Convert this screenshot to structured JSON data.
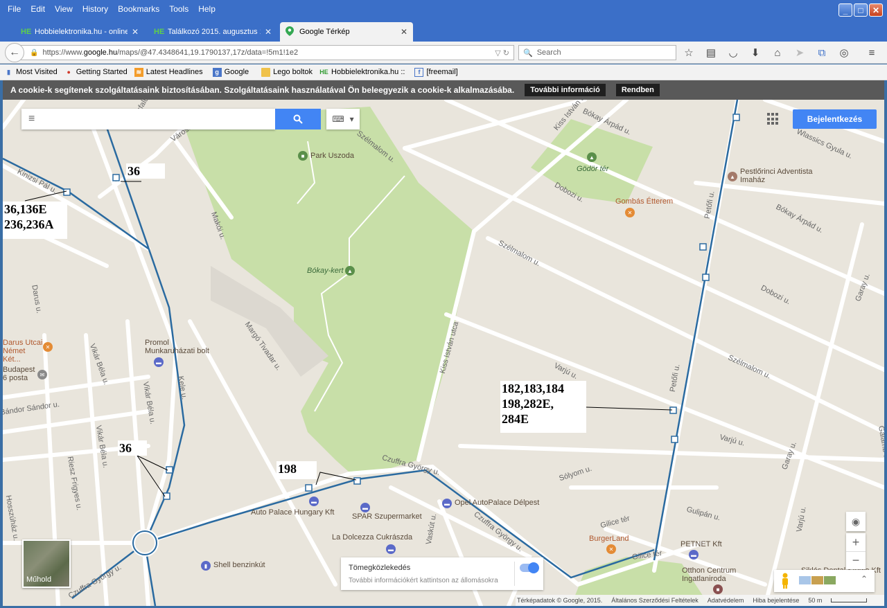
{
  "menu": [
    "File",
    "Edit",
    "View",
    "History",
    "Bookmarks",
    "Tools",
    "Help"
  ],
  "tabs": [
    {
      "favicon": "HE",
      "title": "Hobbielektronika.hu - online e..."
    },
    {
      "favicon": "HE",
      "title": "Találkozó 2015. augusztus 15...."
    },
    {
      "favicon": "maps-icon",
      "title": "Google Térkép"
    }
  ],
  "url": {
    "prefix": "https://www.",
    "host": "google.hu",
    "path": "/maps/@47.4348641,19.1790137,17z/data=!5m1!1e2"
  },
  "search_placeholder": "Search",
  "bookmarks": [
    {
      "icon": "bookmark-icon",
      "label": "Most Visited"
    },
    {
      "icon": "firefox-icon",
      "label": "Getting Started"
    },
    {
      "icon": "rss-icon",
      "label": "Latest Headlines"
    },
    {
      "icon": "google-icon",
      "label": "Google"
    },
    {
      "icon": "folder-icon",
      "label": "Lego boltok"
    },
    {
      "icon": "he-icon",
      "label": "Hobbielektronika.hu ::"
    },
    {
      "icon": "freemail-icon",
      "label": "[freemail]"
    }
  ],
  "cookie": {
    "text": "A cookie-k segítenek szolgáltatásaink biztosításában. Szolgáltatásaink használatával Ön beleegyezik a cookie-k alkalmazásába.",
    "more_label": "További információ",
    "ok_label": "Rendben"
  },
  "map": {
    "signin_label": "Bejelentkezés",
    "satellite_label": "Műhold",
    "transit_title": "Tömegközlekedés",
    "transit_hint": "További információkért kattintson az állomásokra",
    "footer": [
      "Térképadatok © Google, 2015.",
      "Általános Szerződési Feltételek",
      "Adatvédelem",
      "Hiba bejelentése",
      "50 m"
    ],
    "annotations": [
      {
        "lines": [
          "36"
        ]
      },
      {
        "lines": [
          "36,136E",
          "236,236A"
        ]
      },
      {
        "lines": [
          "36"
        ]
      },
      {
        "lines": [
          "198"
        ]
      },
      {
        "lines": [
          "182,183,184",
          "198,282E,",
          "284E"
        ]
      }
    ],
    "places": [
      "Park Uszoda",
      "Gödör tér",
      "Pestlőrinci Adventista Imaház",
      "Gombás Étterem",
      "Bókay-kert",
      "Promol Munkaruházati bolt",
      "Darus Utcai Német Két...",
      "Budapest 6 posta",
      "Auto Palace Hungary Kft",
      "SPAR Szupermarket",
      "Opel AutoPalace Délpest",
      "La Dolcezza Cukrászda",
      "Shell benzinkút",
      "BurgerLand",
      "PETNET Kft",
      "Otthon Centrum Ingatlaniroda",
      "Siklós Dental Studio Kft"
    ],
    "roads": [
      "Kinizsi Pál u.",
      "Szélmalom u.",
      "Kiss István u.",
      "Bókay Árpád u.",
      "Wlassics Gyula u.",
      "Dobozi u.",
      "Bókay Árpád u.",
      "Szélmalom u.",
      "Dobozi u.",
      "Garay u.",
      "Makói u.",
      "Margó Tivadar u.",
      "Kiss István utca",
      "Petőfi u.",
      "Darus u.",
      "Vikár Béla u.",
      "Vikár Béla u.",
      "Kele u.",
      "Vikár Béla u.",
      "Riesz Frigyes u.",
      "Hosszúház u.",
      "Bándor Sándor u.",
      "Varjú u.",
      "Szélmalom u.",
      "Varjú u.",
      "Czuffra György u.",
      "Sólyom u.",
      "Vaskút u.",
      "Czuffra György u.",
      "Gilice tér",
      "Gulipán u.",
      "Varjú u.",
      "Gilice tér",
      "Petőfi u.",
      "Garay u.",
      "Galamb u.",
      "Czuffra György u.",
      "Városkút",
      "Kisfaludy"
    ]
  },
  "colors": {
    "chrome_blue": "#3b6fc8",
    "map_bg": "#e9e5dc",
    "park": "#c8dfa8",
    "transit_line": "#2a6aa0",
    "google_blue": "#4285f4"
  }
}
